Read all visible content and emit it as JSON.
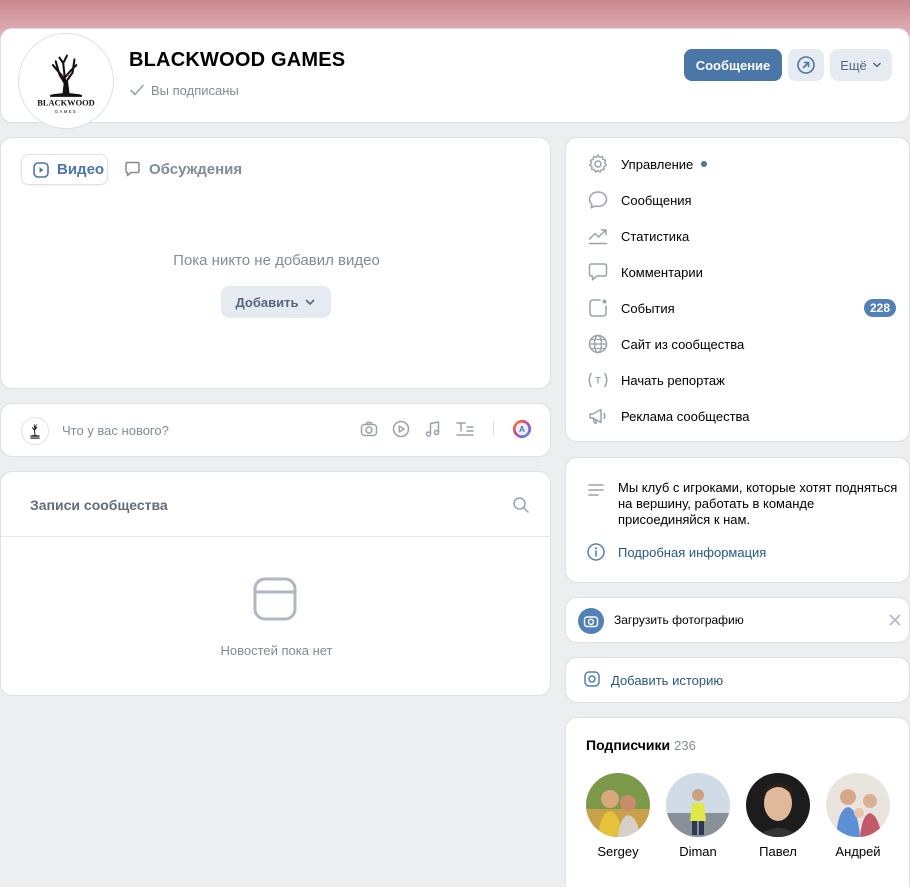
{
  "header": {
    "title": "BLACKWOOD GAMES",
    "subscribed": "Вы подписаны",
    "message_button": "Сообщение",
    "more_button": "Ещё",
    "logo_text": "BLACKWOOD",
    "logo_sub": "GAMES"
  },
  "video_section": {
    "tabs": [
      {
        "label": "Видео"
      },
      {
        "label": "Обсуждения"
      }
    ],
    "empty_text": "Пока никто не добавил видео",
    "add_button": "Добавить"
  },
  "composer": {
    "placeholder": "Что у вас нового?"
  },
  "records": {
    "title": "Записи сообщества",
    "empty_text": "Новостей пока нет"
  },
  "menu": {
    "items": [
      {
        "label": "Управление",
        "icon": "gear-icon"
      },
      {
        "label": "Сообщения",
        "icon": "chat-icon"
      },
      {
        "label": "Статистика",
        "icon": "stats-icon"
      },
      {
        "label": "Комментарии",
        "icon": "comment-icon"
      },
      {
        "label": "События",
        "icon": "event-icon",
        "counter": "228"
      },
      {
        "label": "Сайт из сообщества",
        "icon": "globe-icon"
      },
      {
        "label": "Начать репортаж",
        "icon": "broadcast-icon"
      },
      {
        "label": "Реклама сообщества",
        "icon": "megaphone-icon"
      }
    ]
  },
  "about": {
    "description": "Мы клуб с игроками, которые хотят подняться на вершину, работать в команде присоединяйся к нам.",
    "more_info": "Подробная информация"
  },
  "upload_photo": {
    "label": "Загрузить фотографию"
  },
  "story": {
    "label": "Добавить историю"
  },
  "subscribers": {
    "title": "Подписчики",
    "count": "236",
    "people": [
      {
        "name": "Sergey"
      },
      {
        "name": "Diman"
      },
      {
        "name": "Павел"
      },
      {
        "name": "Андрей"
      }
    ]
  },
  "colors": {
    "accent": "#4a76a8",
    "link": "#2a5885",
    "background": "#edeef0",
    "cover": "#c9868e"
  }
}
